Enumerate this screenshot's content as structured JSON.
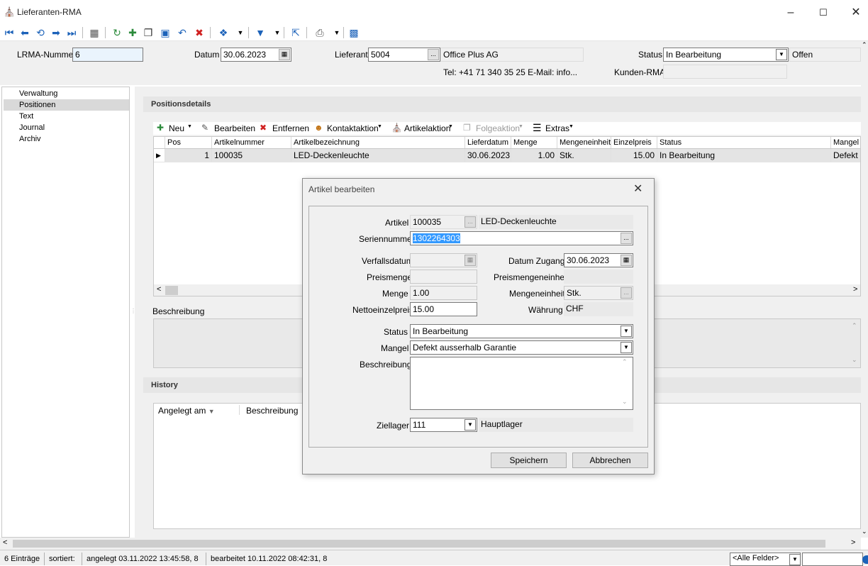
{
  "window": {
    "title": "Lieferanten-RMA"
  },
  "header": {
    "lrma_label": "LRMA-Nummer",
    "lrma_value": "6",
    "datum_label": "Datum",
    "datum_value": "30.06.2023",
    "lieferant_label": "Lieferant",
    "lieferant_value": "5004",
    "lieferant_name": "Office Plus AG",
    "contact": "Tel: +41 71 340 35 25  E-Mail: info...",
    "status_label": "Status",
    "status_value": "In Bearbeitung",
    "status_text": "Offen",
    "kunden_rma_label": "Kunden-RMA",
    "kunden_rma_value": ""
  },
  "nav": {
    "items": [
      "Verwaltung",
      "Positionen",
      "Text",
      "Journal",
      "Archiv"
    ],
    "selected": "Positionen"
  },
  "positions": {
    "title": "Positionsdetails",
    "toolbar": {
      "neu": "Neu",
      "bearbeiten": "Bearbeiten",
      "entfernen": "Entfernen",
      "kontaktaktion": "Kontaktaktion",
      "artikelaktion": "Artikelaktion",
      "folgeaktion": "Folgeaktion",
      "extras": "Extras"
    },
    "columns": [
      "Pos",
      "Artikelnummer",
      "Artikelbezeichnung",
      "Lieferdatum",
      "Menge",
      "Mengeneinheit",
      "Einzelpreis",
      "Status",
      "Mangel"
    ],
    "rows": [
      {
        "pos": "1",
        "artikelnummer": "100035",
        "bezeichnung": "LED-Deckenleuchte",
        "lieferdatum": "30.06.2023",
        "menge": "1.00",
        "einheit": "Stk.",
        "preis": "15.00",
        "status": "In Bearbeitung",
        "mangel": "Defekt a"
      }
    ]
  },
  "beschreibung": {
    "label": "Beschreibung"
  },
  "history": {
    "title": "History",
    "col_angelegt": "Angelegt am",
    "col_beschreibung": "Beschreibung"
  },
  "dialog": {
    "title": "Artikel bearbeiten",
    "artikel_label": "Artikel",
    "artikel_value": "100035",
    "artikel_name": "LED-Deckenleuchte",
    "serien_label": "Seriennummer",
    "serien_value": "1302264303",
    "verfall_label": "Verfallsdatum",
    "verfall_value": "",
    "zugang_label": "Datum Zugang",
    "zugang_value": "30.06.2023",
    "preismenge_label": "Preismenge",
    "preismenge_value": "",
    "preismengeneinheit_label": "Preismengeneinheit",
    "preismengeneinheit_value": "",
    "menge_label": "Menge",
    "menge_value": "1.00",
    "mengeneinheit_label": "Mengeneinheit",
    "mengeneinheit_value": "Stk.",
    "netto_label": "Nettoeinzelpreis",
    "netto_value": "15.00",
    "waehrung_label": "Währung",
    "waehrung_value": "CHF",
    "status_label": "Status",
    "status_value": "In Bearbeitung",
    "mangel_label": "Mangel",
    "mangel_value": "Defekt ausserhalb Garantie",
    "beschreibung_label": "Beschreibung",
    "beschreibung_value": "",
    "ziellager_label": "Ziellager",
    "ziellager_value": "111",
    "ziellager_name": "Hauptlager",
    "save_label": "Speichern",
    "cancel_label": "Abbrechen"
  },
  "statusbar": {
    "count": "6 Einträge",
    "sortiert": "sortiert:",
    "angelegt": "angelegt 03.11.2022 13:45:58,  8",
    "bearbeitet": "bearbeitet 10.11.2022 08:42:31,  8",
    "filter": "<Alle Felder>"
  },
  "colors": {
    "accent_blue": "#1c62b9",
    "selection": "#3399ff"
  }
}
